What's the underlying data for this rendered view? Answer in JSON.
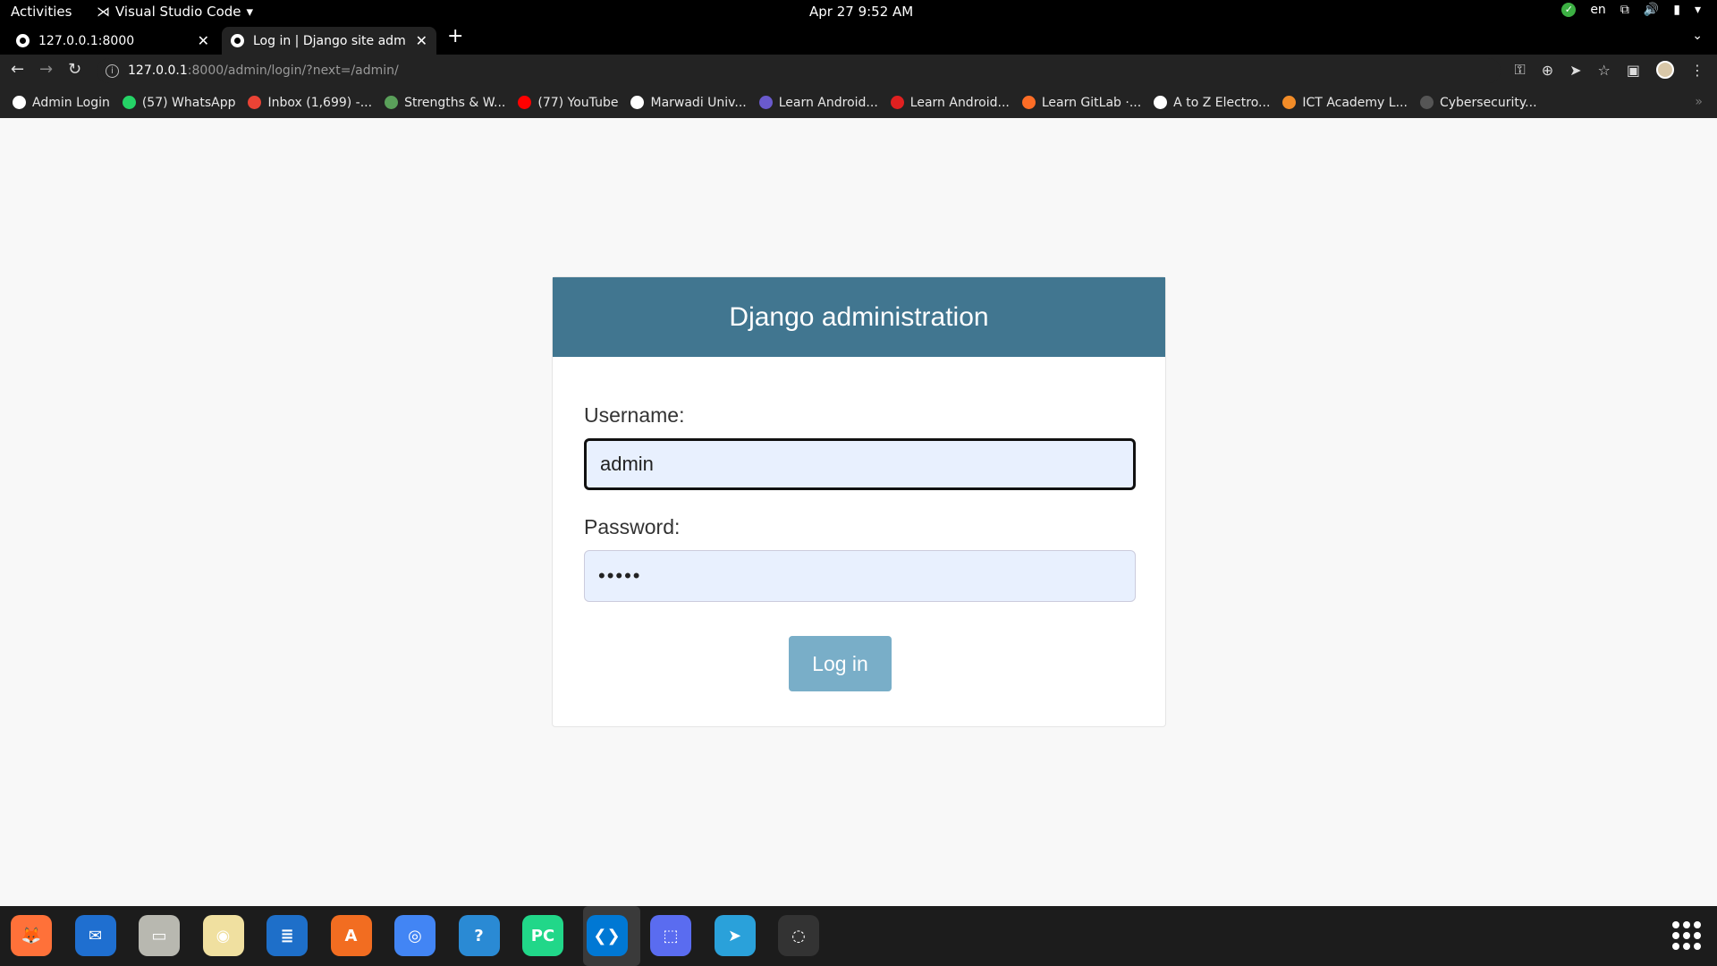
{
  "topbar": {
    "activities": "Activities",
    "app_name": "Visual Studio Code",
    "clock": "Apr 27  9:52 AM",
    "language": "en"
  },
  "tabs": [
    {
      "title": "127.0.0.1:8000"
    },
    {
      "title": "Log in | Django site admin"
    }
  ],
  "address": {
    "host": "127.0.0.1",
    "path": ":8000/admin/login/?next=/admin/"
  },
  "bookmarks": [
    {
      "label": "Admin Login",
      "color": "#ffffff"
    },
    {
      "label": "(57) WhatsApp",
      "color": "#25d366"
    },
    {
      "label": "Inbox (1,699) -...",
      "color": "#ea4335"
    },
    {
      "label": "Strengths & W...",
      "color": "#5aa05a"
    },
    {
      "label": "(77) YouTube",
      "color": "#ff0000"
    },
    {
      "label": "Marwadi Univ...",
      "color": "#ffffff"
    },
    {
      "label": "Learn Android...",
      "color": "#6a5acd"
    },
    {
      "label": "Learn Android...",
      "color": "#e02020"
    },
    {
      "label": "Learn GitLab ·...",
      "color": "#fc6d26"
    },
    {
      "label": "A to Z Electro...",
      "color": "#ffffff"
    },
    {
      "label": "ICT Academy L...",
      "color": "#f28c28"
    },
    {
      "label": "Cybersecurity...",
      "color": "#555555"
    }
  ],
  "login": {
    "header": "Django administration",
    "username_label": "Username:",
    "username_value": "admin",
    "password_label": "Password:",
    "password_value": "•••••",
    "button": "Log in"
  },
  "dock": [
    {
      "name": "firefox-icon",
      "color": "#ff7139",
      "glyph": "🦊"
    },
    {
      "name": "thunderbird-icon",
      "color": "#1f6fd0",
      "glyph": "✉"
    },
    {
      "name": "files-icon",
      "color": "#b8b8b0",
      "glyph": "▭"
    },
    {
      "name": "rhythmbox-icon",
      "color": "#f0e0a0",
      "glyph": "◉"
    },
    {
      "name": "writer-icon",
      "color": "#1e6fc9",
      "glyph": "≣"
    },
    {
      "name": "software-icon",
      "color": "#f26d21",
      "glyph": "A"
    },
    {
      "name": "chrome-icon",
      "color": "#4285f4",
      "glyph": "◎"
    },
    {
      "name": "help-icon",
      "color": "#2a8ad4",
      "glyph": "?"
    },
    {
      "name": "pycharm-icon",
      "color": "#21d789",
      "glyph": "PC"
    },
    {
      "name": "vscode-icon",
      "color": "#0078d4",
      "glyph": "❮❯"
    },
    {
      "name": "screenshot-icon",
      "color": "#5a6cf0",
      "glyph": "⬚"
    },
    {
      "name": "telegram-icon",
      "color": "#2aa1da",
      "glyph": "➤"
    },
    {
      "name": "obs-icon",
      "color": "#333333",
      "glyph": "◌"
    }
  ]
}
